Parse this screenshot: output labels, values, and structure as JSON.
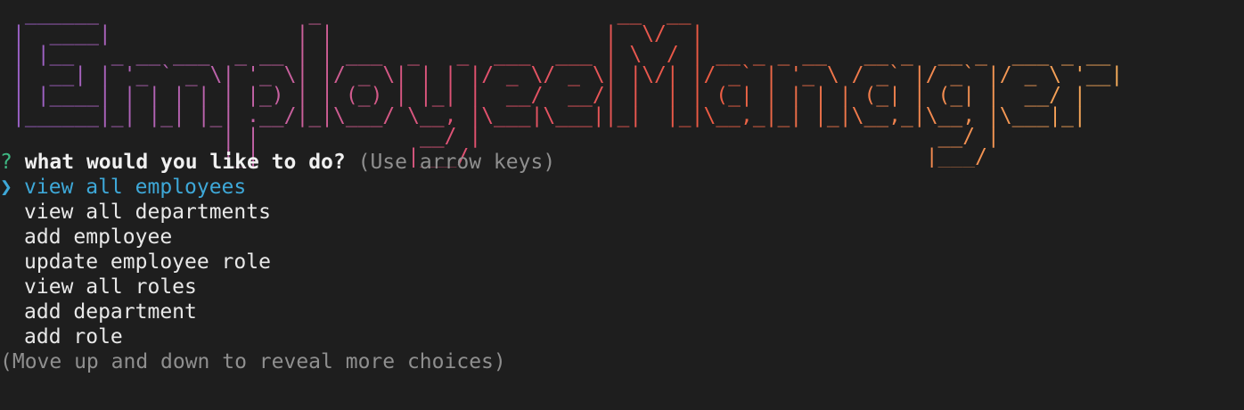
{
  "banner": {
    "title": "Employee Manager"
  },
  "prompt": {
    "mark": "?",
    "question": "what would you like to do?",
    "hint": "(Use arrow keys)",
    "pointer": "❯",
    "choices": [
      {
        "label": "view all employees",
        "selected": true
      },
      {
        "label": "view all departments",
        "selected": false
      },
      {
        "label": "add employee",
        "selected": false
      },
      {
        "label": "update employee role",
        "selected": false
      },
      {
        "label": "view all roles",
        "selected": false
      },
      {
        "label": "add department",
        "selected": false
      },
      {
        "label": "add role",
        "selected": false
      }
    ],
    "footer": "(Move up and down to reveal more choices)"
  },
  "colors": {
    "background": "#1e1e1e",
    "question_mark": "#3fb984",
    "selected_choice": "#3ea8d8",
    "hint": "#8f8f8f",
    "banner_gradient": [
      "#9a62c8",
      "#c463a6",
      "#e2516f",
      "#ec5a43",
      "#f2884f",
      "#f6ad5b"
    ]
  }
}
